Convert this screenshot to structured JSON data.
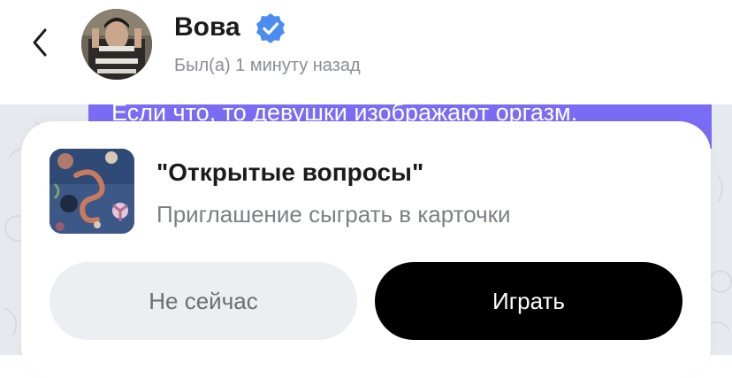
{
  "header": {
    "contact_name": "Вова",
    "status": "Был(а) 1 минуту назад"
  },
  "chat": {
    "last_message": "Если что, то девушки изображают оргазм.",
    "bubble_color": "#7b6cf6"
  },
  "invite": {
    "title": "\"Открытые вопросы\"",
    "subtitle": "Приглашение сыграть в карточки",
    "decline_label": "Не сейчас",
    "accept_label": "Играть"
  },
  "icons": {
    "back": "chevron-left-icon",
    "verified": "verified-badge-icon",
    "verified_color": "#4b8cf0"
  }
}
